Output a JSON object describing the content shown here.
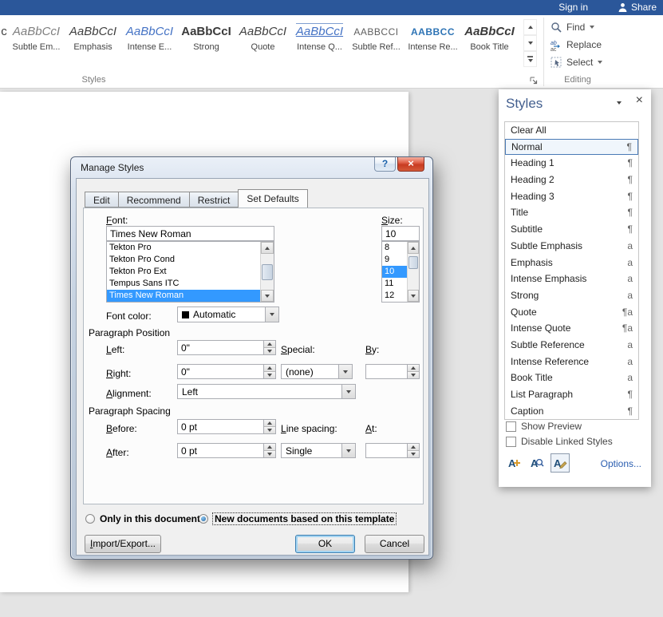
{
  "titlebar": {
    "sign_in": "Sign in",
    "share": "Share"
  },
  "icons": {
    "dialog_help": "?",
    "dialog_close": "×",
    "pane_close": "×"
  },
  "ribbon": {
    "gallery_partial": "c",
    "gallery": [
      {
        "preview": "AaBbCcI",
        "name": "Subtle Em..."
      },
      {
        "preview": "AaBbCcI",
        "name": "Emphasis"
      },
      {
        "preview": "AaBbCcI",
        "name": "Intense E..."
      },
      {
        "preview": "AaBbCcI",
        "name": "Strong"
      },
      {
        "preview": "AaBbCcI",
        "name": "Quote"
      },
      {
        "preview": "AaBbCcI",
        "name": "Intense Q..."
      },
      {
        "preview": "AABBCCI",
        "name": "Subtle Ref..."
      },
      {
        "preview": "AABBCC",
        "name": "Intense Re..."
      },
      {
        "preview": "AaBbCcI",
        "name": "Book Title"
      }
    ],
    "styles_group_label": "Styles",
    "editing_group_label": "Editing",
    "find_label": "Find",
    "replace_label": "Replace",
    "select_label": "Select"
  },
  "styles_pane": {
    "title": "Styles",
    "items": [
      {
        "name": "Clear All",
        "symbol": ""
      },
      {
        "name": "Normal",
        "symbol": "¶"
      },
      {
        "name": "Heading 1",
        "symbol": "¶"
      },
      {
        "name": "Heading 2",
        "symbol": "¶"
      },
      {
        "name": "Heading 3",
        "symbol": "¶"
      },
      {
        "name": "Title",
        "symbol": "¶"
      },
      {
        "name": "Subtitle",
        "symbol": "¶"
      },
      {
        "name": "Subtle Emphasis",
        "symbol": "a"
      },
      {
        "name": "Emphasis",
        "symbol": "a"
      },
      {
        "name": "Intense Emphasis",
        "symbol": "a"
      },
      {
        "name": "Strong",
        "symbol": "a"
      },
      {
        "name": "Quote",
        "symbol": "¶a"
      },
      {
        "name": "Intense Quote",
        "symbol": "¶a"
      },
      {
        "name": "Subtle Reference",
        "symbol": "a"
      },
      {
        "name": "Intense Reference",
        "symbol": "a"
      },
      {
        "name": "Book Title",
        "symbol": "a"
      },
      {
        "name": "List Paragraph",
        "symbol": "¶"
      },
      {
        "name": "Caption",
        "symbol": "¶"
      }
    ],
    "show_preview_label": "Show Preview",
    "disable_linked_label": "Disable Linked Styles",
    "options_label": "Options..."
  },
  "dialog": {
    "title": "Manage Styles",
    "tabs": [
      "Edit",
      "Recommend",
      "Restrict",
      "Set Defaults"
    ],
    "font_label": "Font:",
    "font_value": "Times New Roman",
    "font_list": [
      "Tekton Pro",
      "Tekton Pro Cond",
      "Tekton Pro Ext",
      "Tempus Sans ITC",
      "Times New Roman"
    ],
    "size_label": "Size:",
    "size_value": "10",
    "size_list": [
      "8",
      "9",
      "10",
      "11",
      "12"
    ],
    "font_color_label": "Font color:",
    "font_color_value": "Automatic",
    "paragraph_position_label": "Paragraph Position",
    "paragraph_spacing_label": "Paragraph Spacing",
    "fields": {
      "left_label": "Left:",
      "left_value": "0\"",
      "right_label": "Right:",
      "right_value": "0\"",
      "alignment_label": "Alignment:",
      "alignment_value": "Left",
      "special_label": "Special:",
      "special_value": "(none)",
      "by_label": "By:",
      "by_value": "",
      "before_label": "Before:",
      "before_value": "0 pt",
      "after_label": "After:",
      "after_value": "0 pt",
      "line_spacing_label": "Line spacing:",
      "line_spacing_value": "Single",
      "at_label": "At:",
      "at_value": ""
    },
    "radio_only": "Only in this document",
    "radio_new": "New documents based on this template",
    "buttons": {
      "import_export": "Import/Export...",
      "ok": "OK",
      "cancel": "Cancel"
    }
  }
}
